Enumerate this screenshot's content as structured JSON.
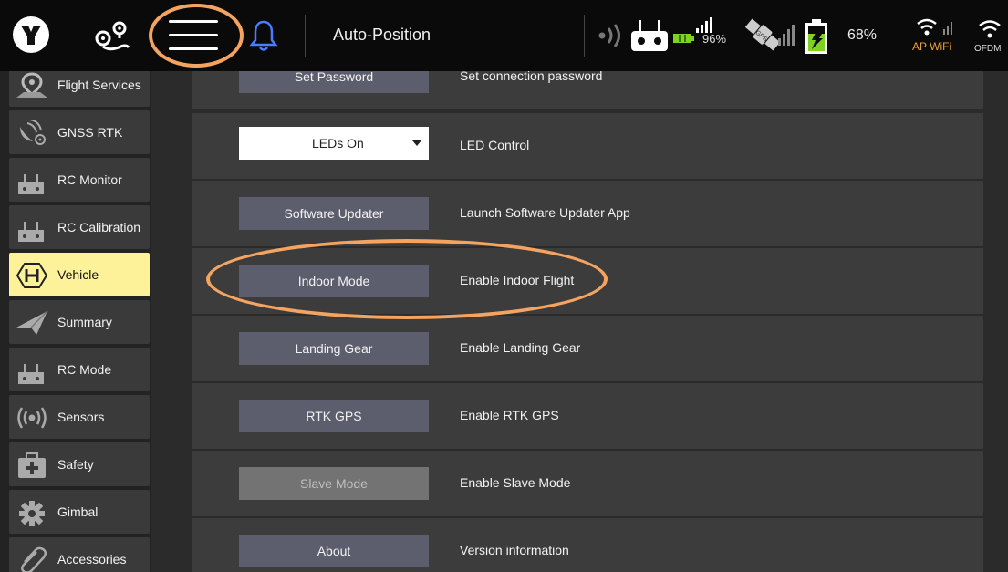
{
  "topbar": {
    "title": "Auto-Position",
    "rc_battery": "96%",
    "aircraft_battery": "68%",
    "ap_wifi_label": "AP WiFi",
    "ofdm_label": "OFDM",
    "gps_icon_text": "GPS"
  },
  "sidebar": {
    "items": [
      {
        "label": "Flight Services",
        "icon": "map-pin-icon"
      },
      {
        "label": "GNSS RTK",
        "icon": "satellite-icon"
      },
      {
        "label": "RC Monitor",
        "icon": "remote-controller-icon"
      },
      {
        "label": "RC Calibration",
        "icon": "remote-controller-icon"
      },
      {
        "label": "Vehicle",
        "icon": "hexagon-h-icon",
        "active": true
      },
      {
        "label": "Summary",
        "icon": "paper-plane-icon"
      },
      {
        "label": "RC Mode",
        "icon": "remote-controller-icon"
      },
      {
        "label": "Sensors",
        "icon": "radio-waves-icon"
      },
      {
        "label": "Safety",
        "icon": "first-aid-kit-icon"
      },
      {
        "label": "Gimbal",
        "icon": "gear-icon"
      },
      {
        "label": "Accessories",
        "icon": "paperclip-icon"
      }
    ]
  },
  "main": {
    "rows": [
      {
        "control": "Set Password",
        "description": "Set connection password"
      },
      {
        "control": "LEDs On",
        "description": "LED Control",
        "type": "select"
      },
      {
        "control": "Software Updater",
        "description": "Launch Software Updater App"
      },
      {
        "control": "Indoor Mode",
        "description": "Enable Indoor Flight"
      },
      {
        "control": "Landing Gear",
        "description": "Enable Landing Gear"
      },
      {
        "control": "RTK GPS",
        "description": "Enable RTK GPS"
      },
      {
        "control": "Slave Mode",
        "description": "Enable Slave Mode",
        "disabled": true
      },
      {
        "control": "About",
        "description": "Version information"
      }
    ]
  },
  "colors": {
    "accent_highlight": "#f4a460",
    "active_item": "#fdf29a",
    "button": "#5d5e6d",
    "bell": "#4a7dff",
    "battery_green": "#7ed321",
    "wifi_orange": "#f0a030"
  }
}
